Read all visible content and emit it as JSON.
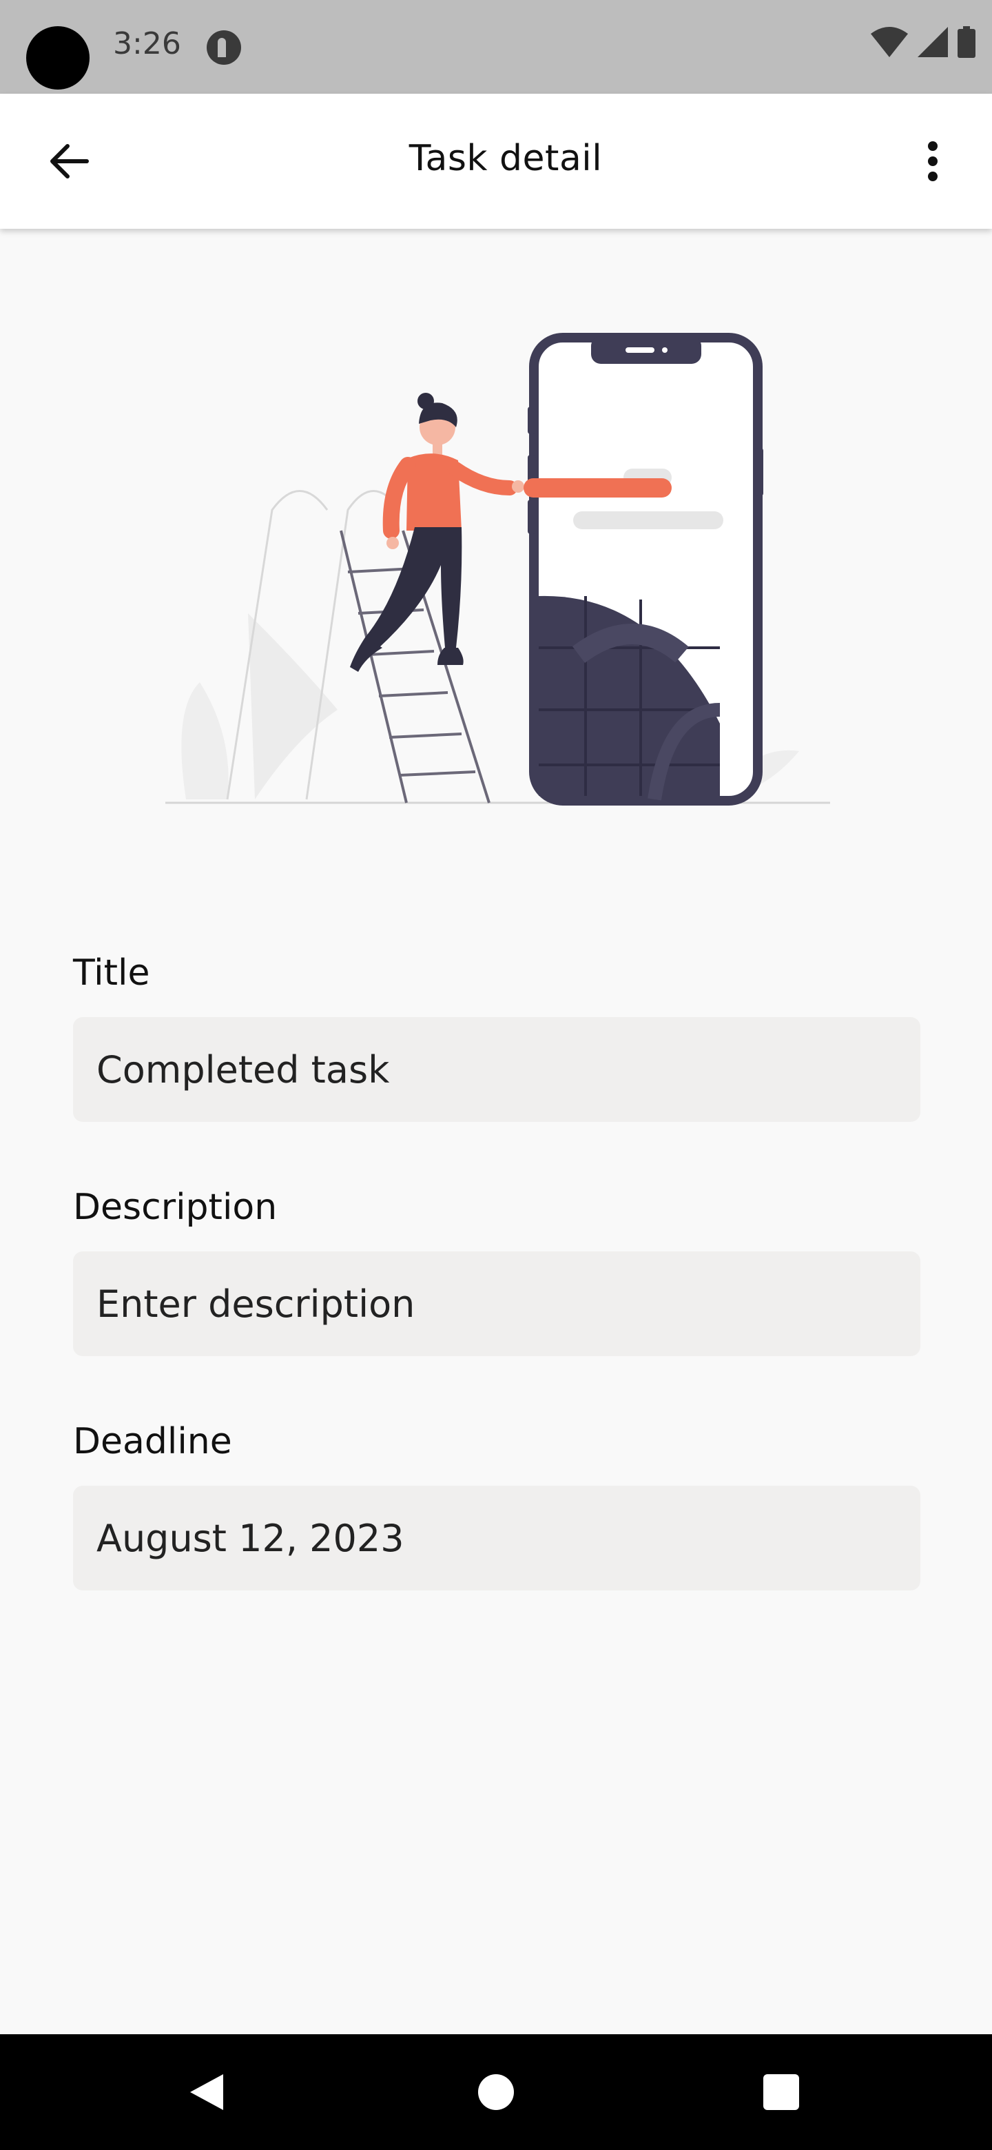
{
  "status_bar": {
    "time": "3:26",
    "icons": [
      "camera-cutout",
      "app-notification-icon",
      "wifi-icon",
      "cell-signal-icon",
      "battery-icon"
    ]
  },
  "app_bar": {
    "title": "Task detail",
    "back_icon": "arrow-back-icon",
    "menu_icon": "more-vertical-icon"
  },
  "illustration": {
    "description_icon": "woman-on-ladder-with-phone-illustration",
    "colors": {
      "accent": "#f07154",
      "dark": "#3f3d56",
      "light": "#e6e6e6"
    }
  },
  "form": {
    "title_label": "Title",
    "title_value": "Completed task",
    "description_label": "Description",
    "description_value": "Enter description",
    "deadline_label": "Deadline",
    "deadline_value": "August 12, 2023"
  },
  "nav_bar": {
    "icons": [
      "nav-back-icon",
      "nav-home-icon",
      "nav-recents-icon"
    ]
  },
  "colors": {
    "background": "#f9f9f9",
    "app_bar": "#ffffff",
    "status_bar": "#bdbdbd",
    "field_bg": "#f0efee"
  }
}
